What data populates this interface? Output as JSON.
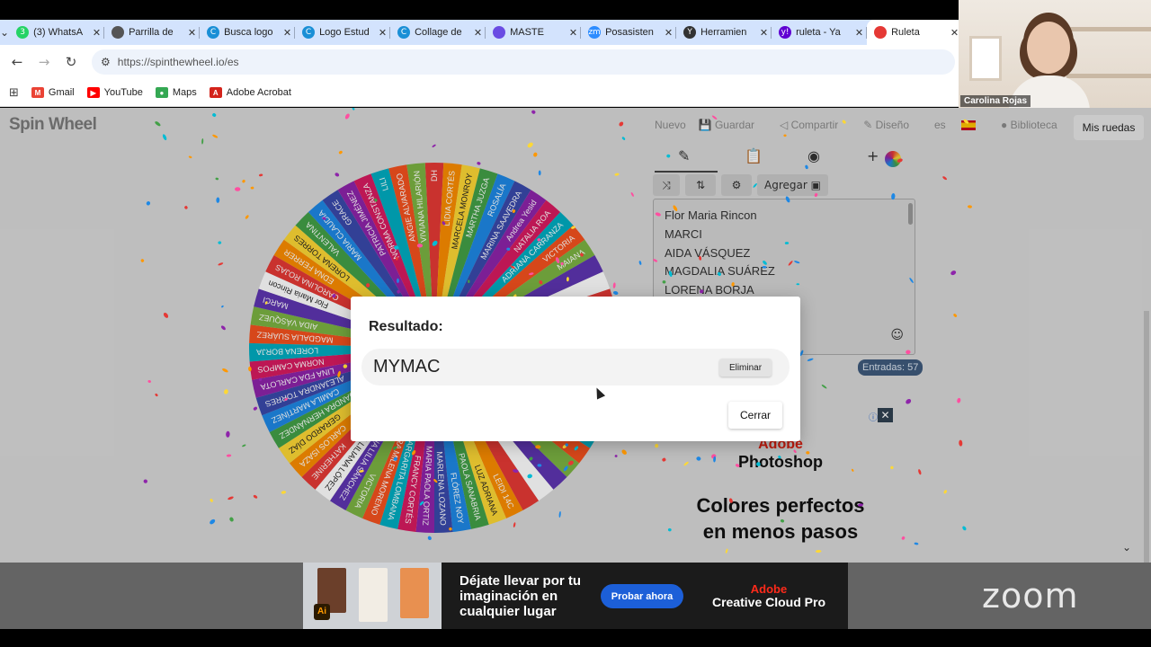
{
  "browser": {
    "tabs": [
      {
        "label": "(3) WhatsA",
        "icon": "whatsapp-icon",
        "color": "#25d366",
        "glyph": "3"
      },
      {
        "label": "Parrilla de",
        "icon": "globe-icon",
        "color": "#555555",
        "glyph": ""
      },
      {
        "label": "Busca logo",
        "icon": "canva-icon",
        "color": "#1a8fd6",
        "glyph": "C"
      },
      {
        "label": "Logo Estud",
        "icon": "canva-icon",
        "color": "#1a8fd6",
        "glyph": "C"
      },
      {
        "label": "Collage de",
        "icon": "canva-icon",
        "color": "#1a8fd6",
        "glyph": "C"
      },
      {
        "label": "MASTE",
        "icon": "app-icon",
        "color": "#6a4ce3",
        "glyph": ""
      },
      {
        "label": "Posasisten",
        "icon": "zoom-icon",
        "color": "#2d8cff",
        "glyph": "zm"
      },
      {
        "label": "Herramien",
        "icon": "y-icon",
        "color": "#333333",
        "glyph": "Y"
      },
      {
        "label": "ruleta - Ya",
        "icon": "yahoo-icon",
        "color": "#6001d2",
        "glyph": "y!"
      },
      {
        "label": "Ruleta",
        "icon": "chrome-icon",
        "color": "#e53935",
        "glyph": ""
      }
    ],
    "url": "https://spinthewheel.io/es",
    "bookmarks": [
      {
        "label": "Gmail",
        "icon": "gmail-icon",
        "color": "#ea4335",
        "glyph": "M"
      },
      {
        "label": "YouTube",
        "icon": "youtube-icon",
        "color": "#ff0000",
        "glyph": "▶"
      },
      {
        "label": "Maps",
        "icon": "maps-icon",
        "color": "#34a853",
        "glyph": "●"
      },
      {
        "label": "Adobe Acrobat",
        "icon": "acrobat-icon",
        "color": "#d4231b",
        "glyph": "A"
      }
    ]
  },
  "webcam": {
    "name": "Carolina Rojas"
  },
  "app": {
    "logo": "Spin Wheel",
    "menu": [
      "Nuevo",
      "Guardar",
      "Compartir",
      "Diseño",
      "es",
      "Biblioteca"
    ],
    "my_wheels": "Mis ruedas",
    "add_label": "Agregar",
    "entries_list": [
      "Flor Maria Rincon",
      "MARCI",
      "AIDA VÁSQUEZ",
      "MAGDALIA SUÁREZ",
      "LORENA BORJA"
    ],
    "entries_count": "Entradas: 57",
    "wheel_names": [
      "DH",
      "LIDIA CORTÉS",
      "MARCELA MONROY",
      "MARTHA JUZGA",
      "ROSALÍA",
      "MARINA SAAVEDRA",
      "Andrea Yesid",
      "NATALIA ROA",
      "ADRIANA CARRANZA",
      "VICTORIA",
      "MAIANA",
      "",
      "",
      "",
      "",
      "",
      "",
      "",
      "",
      "",
      "",
      "",
      "",
      "",
      "",
      "",
      "",
      "LEIDI 14C",
      "LUZ ADRIANA",
      "PAOLA SANABRIA",
      "FLÓREZ NOY",
      "MARLENA LOZANO",
      "MARIA PAOLA ORTIZ",
      "FRANCY CORTÉS",
      "MARGARITA LOMBANA",
      "DORA MILENA MORENO",
      "VICTORIA",
      "ANA LILIA SÁNCHEZ",
      "ANA LILIANA LÓPEZ",
      "KATHERINE",
      "CARLOS ISAZA",
      "GERARDO DÍAZ",
      "ALEJANDRA HERNÁNDEZ",
      "CAMILA MARTÍNEZ",
      "ALEJANDRA TORRES",
      "LINA FDA CARLOTA",
      "NORMA CAMPOS",
      "LORENA BORJA",
      "MAGDALIA SUÁREZ",
      "AIDA VÁSQUEZ",
      "MARCI",
      "Flor Maria Rincon",
      "CAROLINA ROJAS",
      "EDNA FERRER",
      "LORENA TORRES",
      "VALENTINA",
      "MARIA CLAUDIA",
      "GRACE",
      "PATRICIA JIMÉNEZ",
      "NORMA CONSTANZA",
      "LILI",
      "ANGIE ALVARADO",
      "VIVIANA HILARIÓN"
    ],
    "wheel_colors": [
      "#e53935",
      "#fb8c00",
      "#fdd835",
      "#43a047",
      "#1e88e5",
      "#3949ab",
      "#8e24aa",
      "#d81b60",
      "#00acc1",
      "#f4511e",
      "#7cb342",
      "#5e35b1",
      "#ffffff"
    ]
  },
  "ad_side": {
    "brand": "Adobe",
    "product": "Photoshop",
    "headline_line1": "Colores perfectos",
    "headline_line2": "en menos pasos"
  },
  "ad_bottom": {
    "text": "Déjate llevar por tu imaginación en cualquier lugar",
    "cta": "Probar ahora",
    "brand": "Adobe",
    "product": "Creative Cloud Pro",
    "badge": "Ai"
  },
  "zoom_logo": "zoom",
  "modal": {
    "title": "Resultado:",
    "result": "MYMAC",
    "remove_label": "Eliminar",
    "close_label": "Cerrar"
  },
  "confetti_colors": [
    "#e53935",
    "#fdd835",
    "#43a047",
    "#1e88e5",
    "#8e24aa",
    "#ff4fa0",
    "#00bcd4",
    "#ff9800"
  ]
}
